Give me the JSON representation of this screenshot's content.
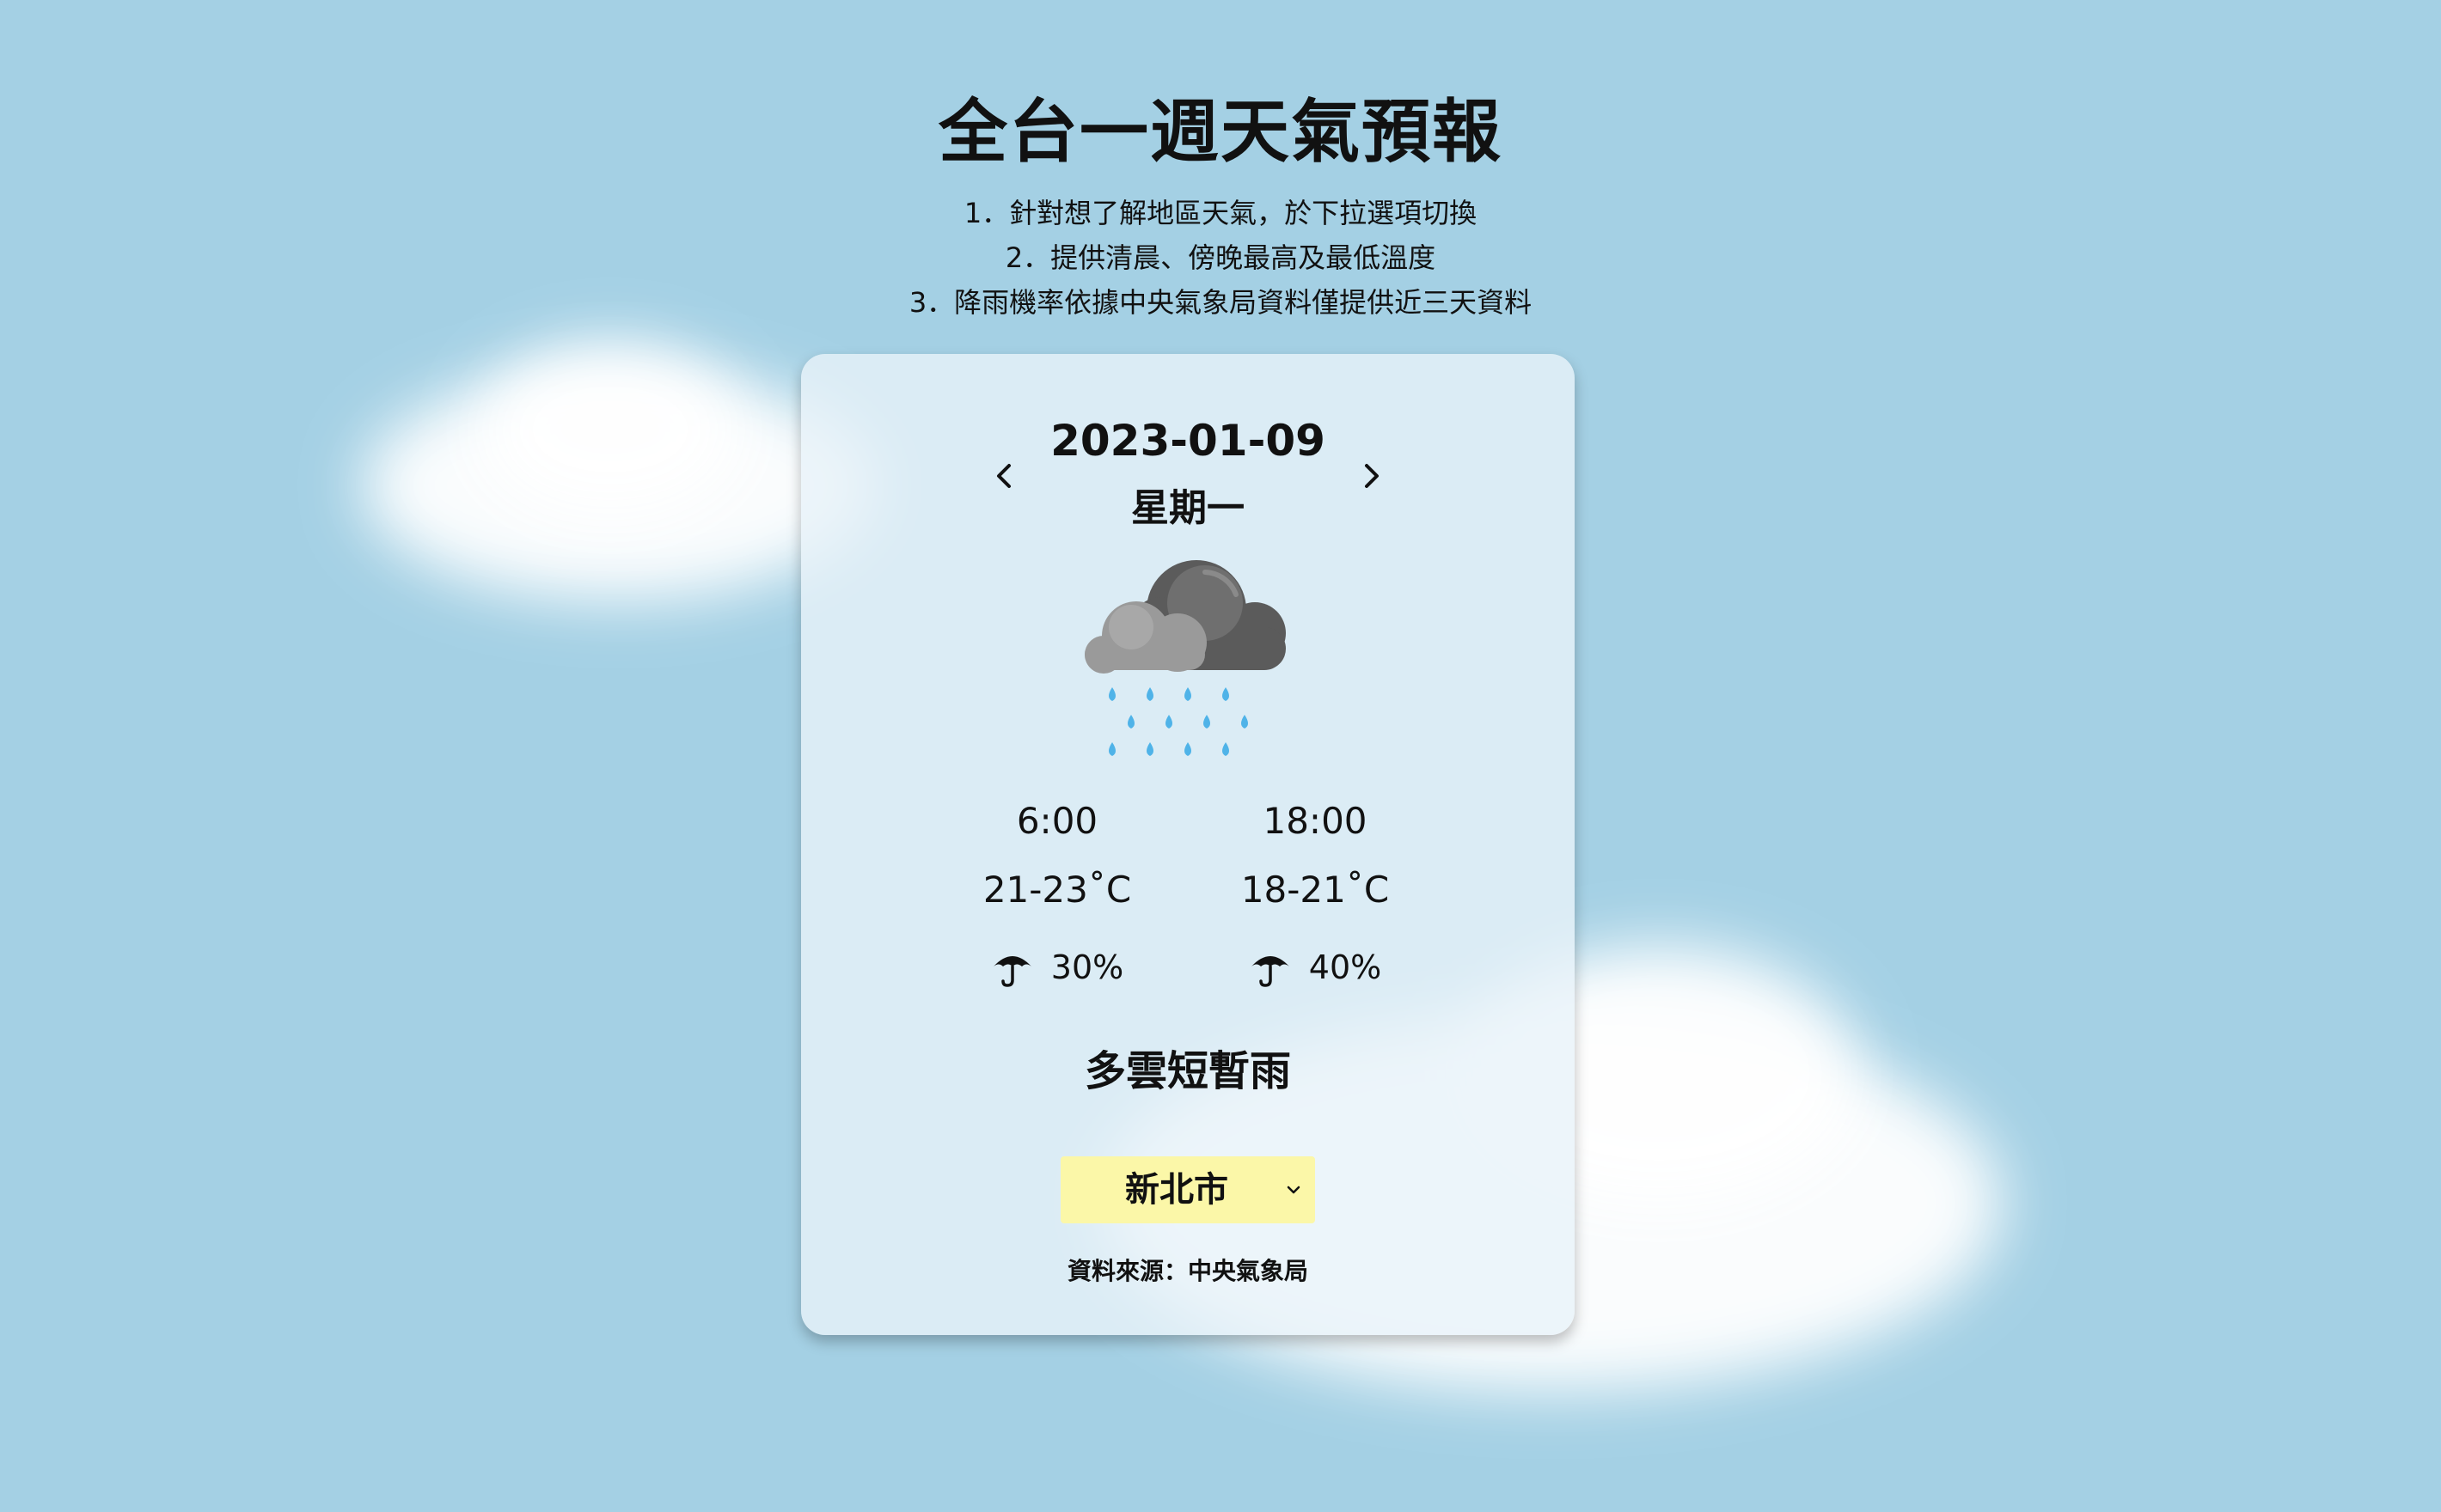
{
  "header": {
    "title": "全台一週天氣預報",
    "instructions": [
      "1．針對想了解地區天氣，於下拉選項切換",
      "2．提供清晨、傍晚最高及最低溫度",
      "3．降雨機率依據中央氣象局資料僅提供近三天資料"
    ]
  },
  "card": {
    "date": "2023-01-09",
    "weekday": "星期一",
    "weather_icon": "cloud-rain-icon",
    "forecasts": [
      {
        "time": "6:00",
        "temp": "21-23˚C",
        "rain": "30%"
      },
      {
        "time": "18:00",
        "temp": "18-21˚C",
        "rain": "40%"
      }
    ],
    "description": "多雲短暫雨",
    "city": {
      "selected": "新北市"
    },
    "source": "資料來源：中央氣象局"
  },
  "colors": {
    "background": "#a4d0e4",
    "select_background": "#fbf7a8"
  }
}
